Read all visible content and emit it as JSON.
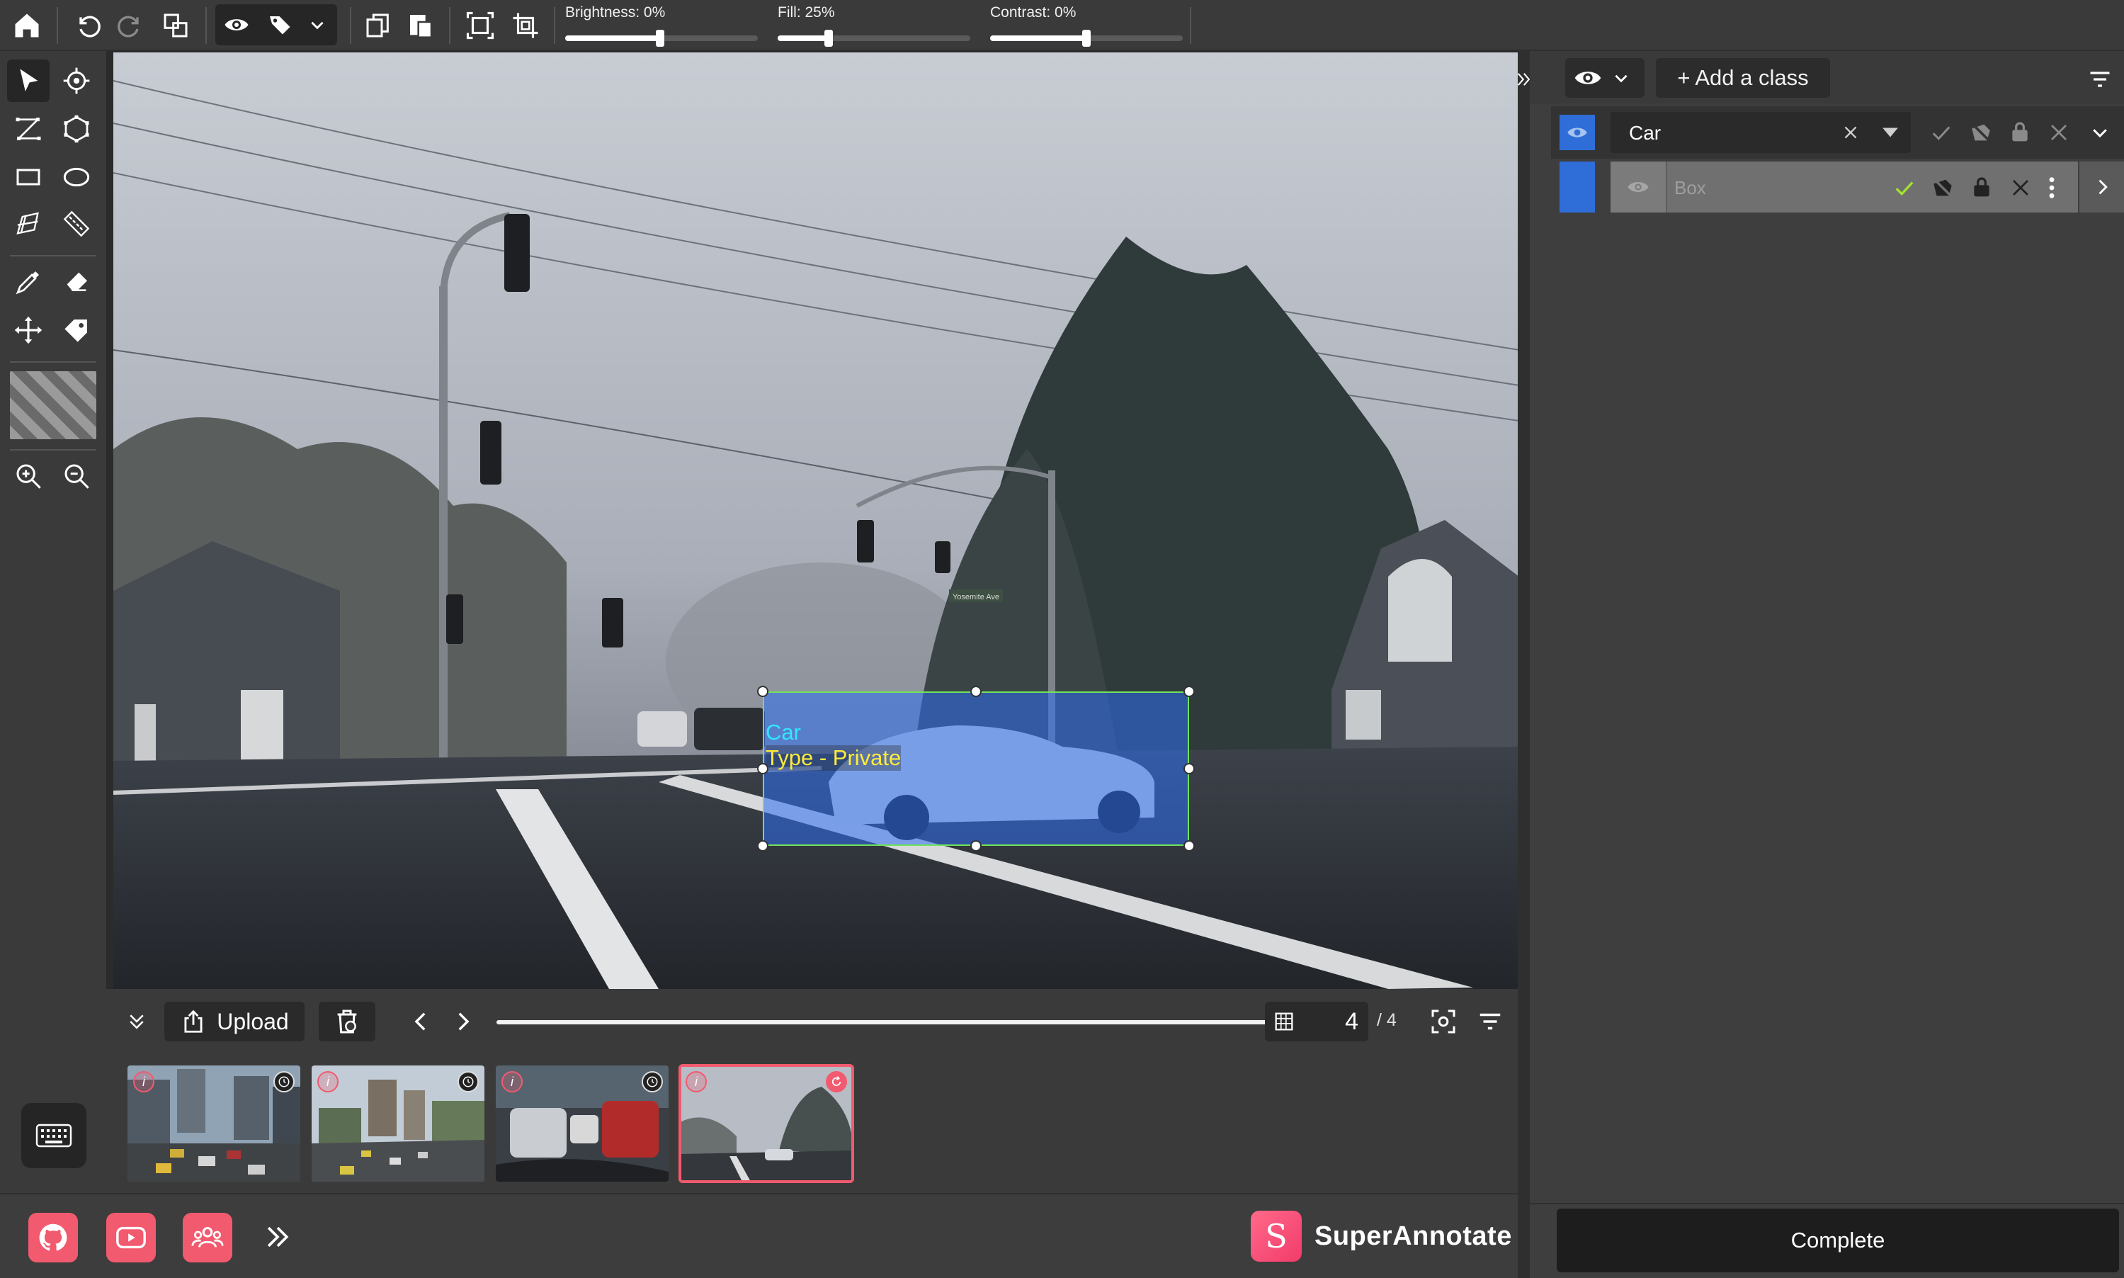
{
  "toolbar": {
    "brightness_label": "Brightness: 0%",
    "brightness_value": 0,
    "fill_label": "Fill: 25%",
    "fill_value": 25,
    "contrast_label": "Contrast: 0%",
    "contrast_value": 0
  },
  "canvas": {
    "annotation": {
      "class_label": "Car",
      "attribute_label": "Type - Private",
      "class_label_color": "#33e6ff",
      "attribute_label_color": "#ffeb3b",
      "box_color": "#2e6ef0"
    },
    "street_sign": "Yosemite Ave"
  },
  "navbar": {
    "upload_label": "Upload",
    "progress": 1.0,
    "current_image": "4",
    "total_images": "/ 4"
  },
  "thumbnails": [
    {
      "status": "pending",
      "active": false
    },
    {
      "status": "pending",
      "active": false
    },
    {
      "status": "pending",
      "active": false
    },
    {
      "status": "returned",
      "active": true
    }
  ],
  "footer": {
    "brand": "SuperAnnotate",
    "brand_color": "#f25a6f"
  },
  "right_panel": {
    "add_class_label": "+ Add a class",
    "class_name": "Car",
    "class_color": "#2f6ed8",
    "instance_label": "Box",
    "complete_label": "Complete"
  }
}
